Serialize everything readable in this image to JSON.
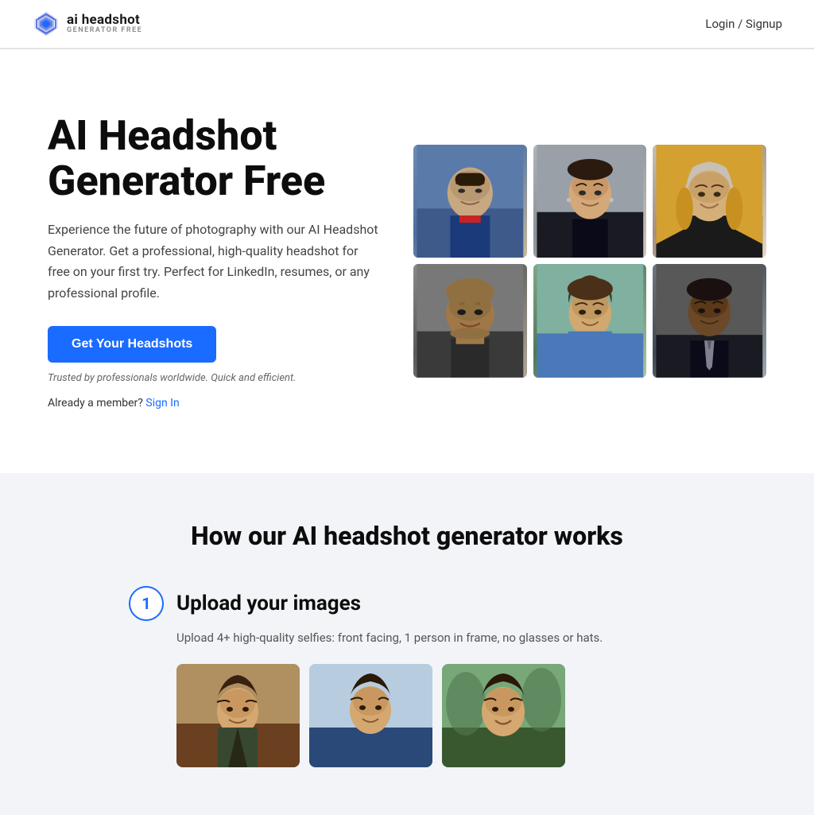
{
  "brand": {
    "logo_text": "ai headshot",
    "logo_sub": "GENERATOR FREE",
    "logo_icon": "diamond-icon"
  },
  "header": {
    "auth_label": "Login / Signup"
  },
  "hero": {
    "title": "AI Headshot Generator Free",
    "description": "Experience the future of photography with our AI Headshot Generator. Get a professional, high-quality headshot for free on your first try. Perfect for LinkedIn, resumes, or any professional profile.",
    "cta_button": "Get Your Headshots",
    "trusted_text": "Trusted by professionals worldwide. Quick and efficient.",
    "member_text": "Already a member?",
    "signin_text": "Sign In"
  },
  "headshots": {
    "grid": [
      {
        "id": "hs1",
        "alt": "professional male headshot dark hair suit"
      },
      {
        "id": "hs2",
        "alt": "professional female headshot dark hair"
      },
      {
        "id": "hs3",
        "alt": "professional female headshot blonde"
      },
      {
        "id": "hs4",
        "alt": "bald man professional headshot"
      },
      {
        "id": "hs5",
        "alt": "young male headshot outdoor"
      },
      {
        "id": "hs6",
        "alt": "black male professional headshot suit"
      }
    ]
  },
  "how_section": {
    "title": "How our AI headshot generator works",
    "step1": {
      "number": "1",
      "label": "Upload your images",
      "description": "Upload 4+ high-quality selfies: front facing, 1 person in frame, no glasses or hats."
    }
  },
  "sample_photos": [
    {
      "id": "sp1",
      "alt": "sample selfie 1"
    },
    {
      "id": "sp2",
      "alt": "sample selfie 2"
    },
    {
      "id": "sp3",
      "alt": "sample selfie 3"
    }
  ]
}
